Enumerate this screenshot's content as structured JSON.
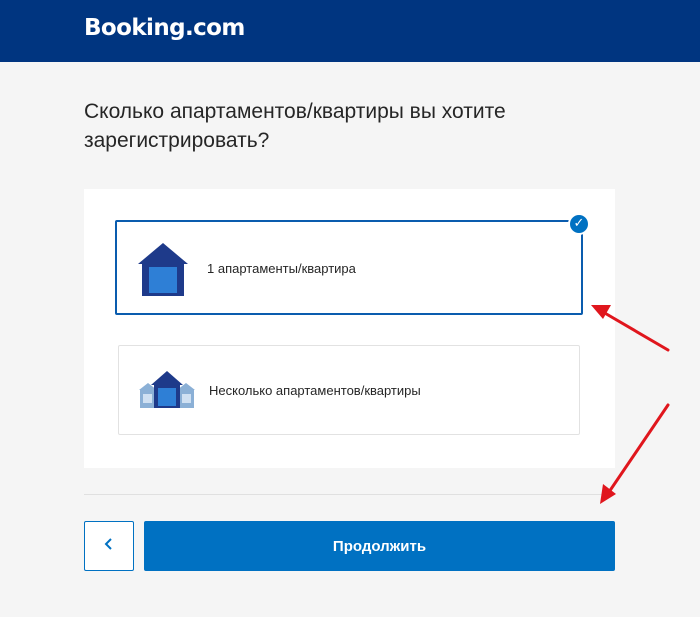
{
  "header": {
    "logo_text": "Booking.com",
    "background_color": "#003580"
  },
  "main": {
    "question": "Сколько апартаментов/квартиры вы хотите зарегистрировать?",
    "options": [
      {
        "label": "1 апартаменты/квартира",
        "icon": "single-house-icon",
        "selected": true
      },
      {
        "label": "Несколько апартаментов/квартиры",
        "icon": "multiple-houses-icon",
        "selected": false
      }
    ],
    "selected_check_icon": "checkmark-icon"
  },
  "footer": {
    "back_icon": "chevron-left-icon",
    "continue_label": "Продолжить"
  },
  "colors": {
    "brand_dark": "#003580",
    "accent": "#0071c2",
    "selected_border": "#0a5cae",
    "annotation_arrow": "#e0161d"
  }
}
